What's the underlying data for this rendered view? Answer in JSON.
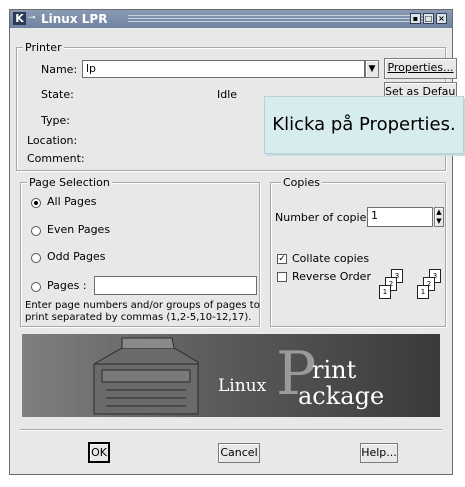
{
  "window": {
    "title": "Linux LPR",
    "controls": {
      "minimize": "▪",
      "maximize": "□",
      "close": "×"
    }
  },
  "printer": {
    "group_title": "Printer",
    "name_label": "Name:",
    "name_value": "lp",
    "properties_button": "Properties...",
    "setdefault_button": "Set as Default",
    "state_label": "State:",
    "state_value": "Idle",
    "type_label": "Type:",
    "location_label": "Location:",
    "comment_label": "Comment:"
  },
  "tooltip": {
    "text": "Klicka på Properties."
  },
  "page_selection": {
    "group_title": "Page Selection",
    "all_pages": "All Pages",
    "even_pages": "Even Pages",
    "odd_pages": "Odd Pages",
    "pages": "Pages :",
    "pages_value": "",
    "help_text_line1": "Enter page numbers and/or groups of pages to",
    "help_text_line2": "print separated by commas (1,2-5,10-12,17).",
    "selected": "all_pages"
  },
  "copies": {
    "group_title": "Copies",
    "number_label": "Number of copies:",
    "number_value": "1",
    "collate_label": "Collate copies",
    "collate_checked": true,
    "reverse_label": "Reverse Order",
    "reverse_checked": false,
    "stack_labels": [
      "3",
      "2",
      "1"
    ]
  },
  "banner": {
    "linux": "Linux",
    "p": "P",
    "rint": "rint",
    "ackage": "ackage"
  },
  "buttons": {
    "ok": "OK",
    "cancel": "Cancel",
    "help": "Help..."
  }
}
